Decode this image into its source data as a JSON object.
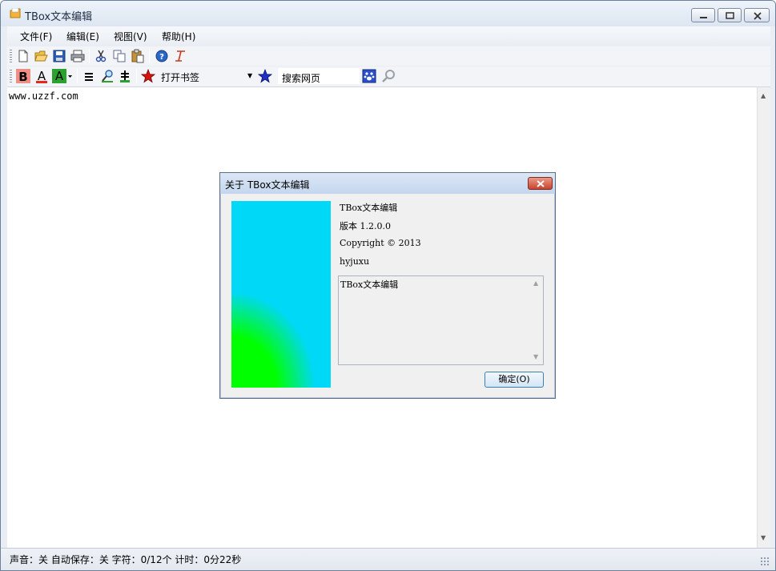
{
  "window": {
    "title": "TBox文本编辑",
    "icon": "folder-icon"
  },
  "menu": {
    "items": [
      {
        "label": "文件(F)"
      },
      {
        "label": "编辑(E)"
      },
      {
        "label": "视图(V)"
      },
      {
        "label": "帮助(H)"
      }
    ]
  },
  "toolbar": {
    "bookmark_label": "打开书签",
    "search_value": "搜索网页"
  },
  "editor": {
    "content": "www.uzzf.com"
  },
  "status": {
    "text": "声音：关 自动保存：关 字符：0/12个 计时：0分22秒"
  },
  "about_dialog": {
    "title": "关于 TBox文本编辑",
    "product_name": "TBox文本编辑",
    "version": "版本 1.2.0.0",
    "copyright": "Copyright © 2013",
    "author": "hyjuxu",
    "description": "TBox文本编辑",
    "ok_label": "确定(O)"
  }
}
